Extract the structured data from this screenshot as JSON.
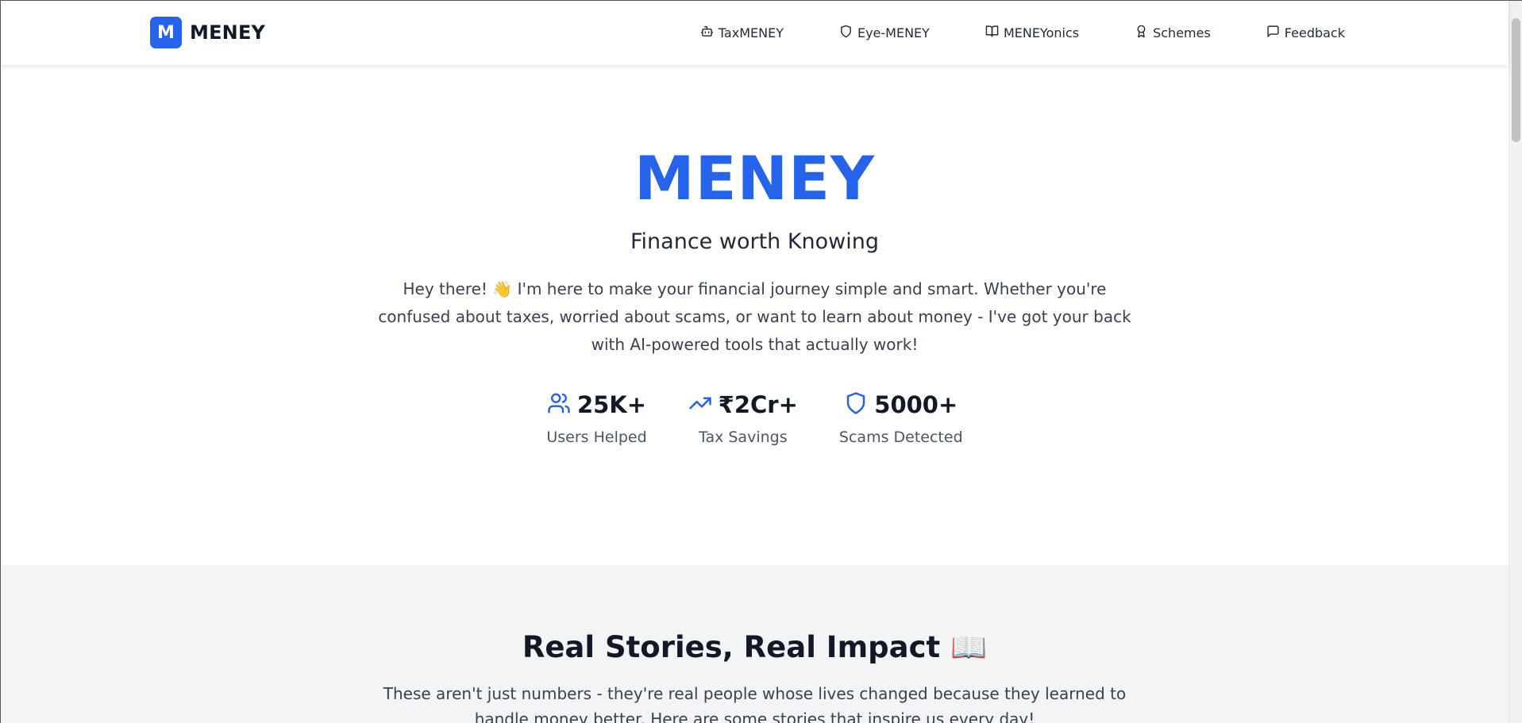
{
  "brand": {
    "logo_letter": "M",
    "name": "MENEY"
  },
  "nav": {
    "items": [
      {
        "label": "TaxMENEY",
        "icon": "bot-icon"
      },
      {
        "label": "Eye-MENEY",
        "icon": "shield-icon"
      },
      {
        "label": "MENEYonics",
        "icon": "book-open-icon"
      },
      {
        "label": "Schemes",
        "icon": "award-icon"
      },
      {
        "label": "Feedback",
        "icon": "message-square-icon"
      }
    ]
  },
  "hero": {
    "title": "MENEY",
    "subtitle": "Finance worth Knowing",
    "description": "Hey there! 👋 I'm here to make your financial journey simple and smart. Whether you're confused about taxes, worried about scams, or want to learn about money - I've got your back with AI-powered tools that actually work!",
    "stats": [
      {
        "value": "25K+",
        "label": "Users Helped",
        "icon": "users-icon"
      },
      {
        "value": "₹2Cr+",
        "label": "Tax Savings",
        "icon": "trending-up-icon"
      },
      {
        "value": "5000+",
        "label": "Scams Detected",
        "icon": "shield-icon"
      }
    ]
  },
  "stories": {
    "title": "Real Stories, Real Impact 📖",
    "description": "These aren't just numbers - they're real people whose lives changed because they learned to handle money better. Here are some stories that inspire us every day!"
  },
  "colors": {
    "accent": "#2563eb",
    "text_dark": "#111827",
    "section_bg": "#f3f4f6"
  }
}
